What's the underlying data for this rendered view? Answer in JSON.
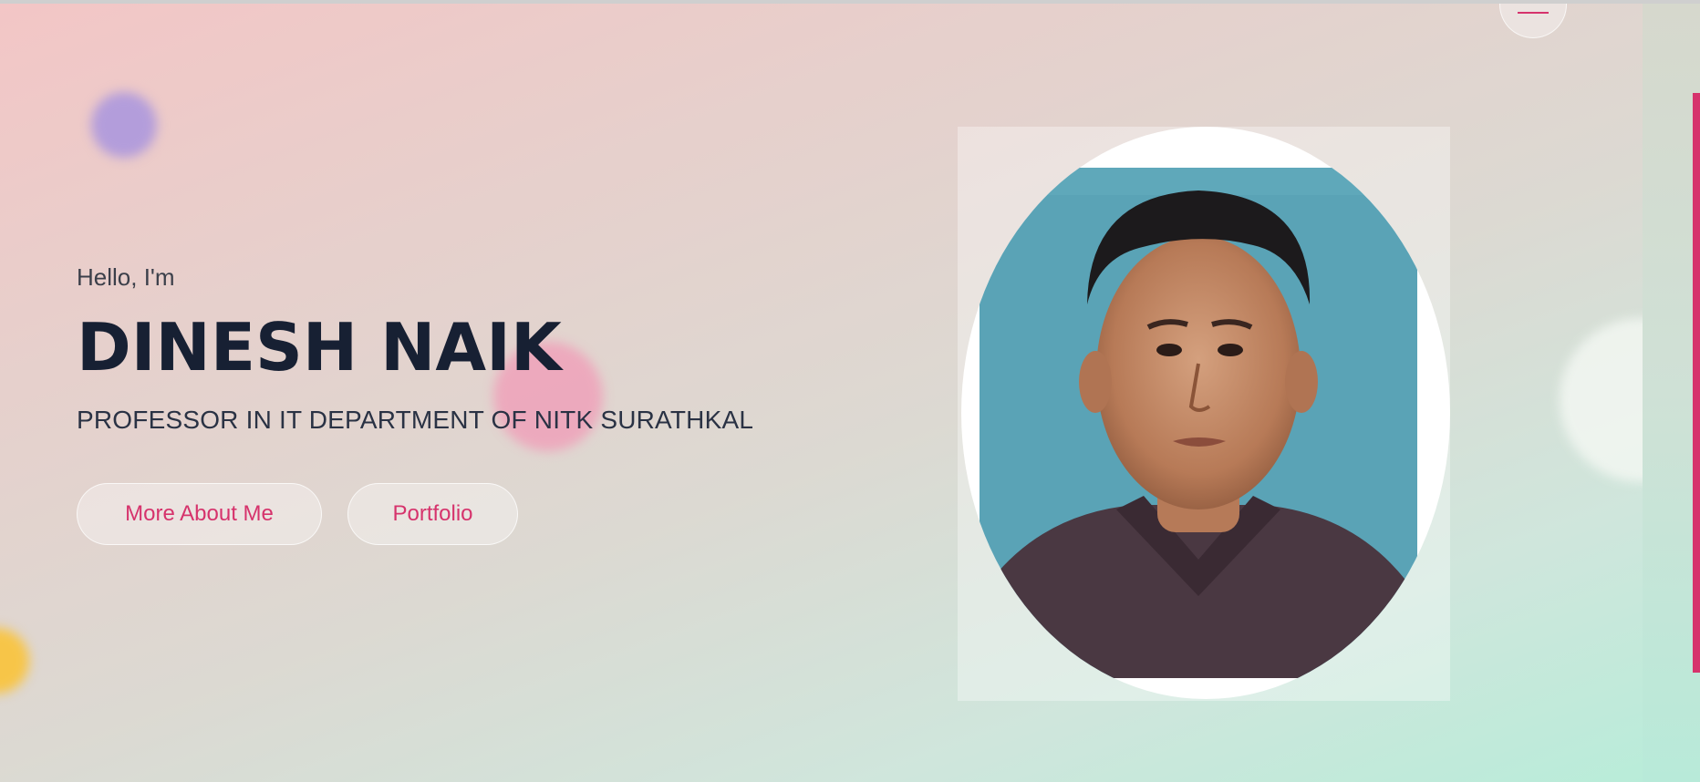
{
  "hero": {
    "greeting": "Hello, I'm",
    "name": "DINESH NAIK",
    "subtitle": "PROFESSOR IN IT DEPARTMENT OF NITK SURATHKAL",
    "buttons": {
      "about_label": "More About Me",
      "portfolio_label": "Portfolio"
    }
  },
  "nav": {
    "menu_icon": "hamburger-icon"
  },
  "profile_photo": {
    "icon": "profile-photo"
  },
  "colors": {
    "accent": "#d6336c",
    "heading": "#172033",
    "text": "#2a3244"
  }
}
